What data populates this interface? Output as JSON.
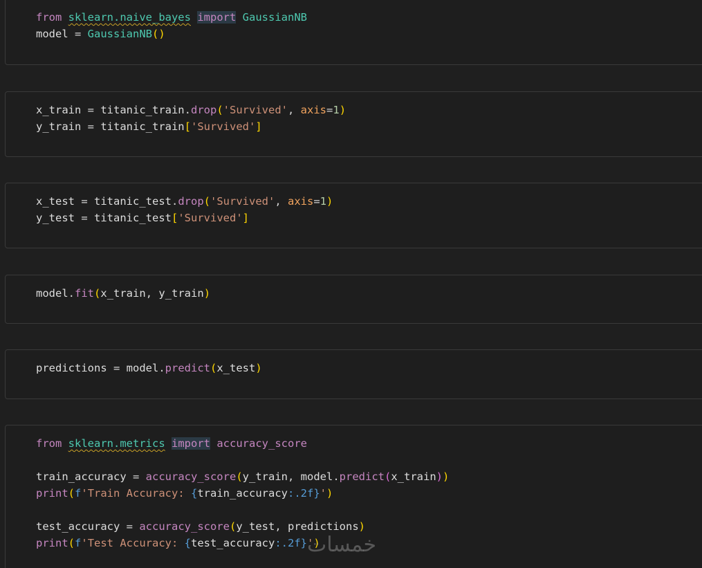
{
  "cells": [
    {
      "name": "cell-import-gaussiannb",
      "lines": [
        [
          [
            "kw",
            "from"
          ],
          [
            "op",
            " "
          ],
          [
            "mod",
            "sklearn.naive_bayes"
          ],
          [
            "op",
            " "
          ],
          [
            "kw-hl",
            "import"
          ],
          [
            "op",
            " "
          ],
          [
            "cls",
            "GaussianNB"
          ]
        ],
        [
          [
            "var",
            "model"
          ],
          [
            "op",
            " = "
          ],
          [
            "cls",
            "GaussianNB"
          ],
          [
            "br1",
            "()"
          ]
        ]
      ]
    },
    {
      "name": "cell-train-split",
      "lines": [
        [
          [
            "var",
            "x_train"
          ],
          [
            "op",
            " = "
          ],
          [
            "var",
            "titanic_train"
          ],
          [
            "op",
            "."
          ],
          [
            "fnp",
            "drop"
          ],
          [
            "br1",
            "("
          ],
          [
            "str",
            "'Survived'"
          ],
          [
            "op",
            ", "
          ],
          [
            "param",
            "axis"
          ],
          [
            "op",
            "="
          ],
          [
            "num",
            "1"
          ],
          [
            "br1",
            ")"
          ]
        ],
        [
          [
            "var",
            "y_train"
          ],
          [
            "op",
            " = "
          ],
          [
            "var",
            "titanic_train"
          ],
          [
            "br1",
            "["
          ],
          [
            "str",
            "'Survived'"
          ],
          [
            "br1",
            "]"
          ]
        ]
      ]
    },
    {
      "name": "cell-test-split",
      "lines": [
        [
          [
            "var",
            "x_test"
          ],
          [
            "op",
            " = "
          ],
          [
            "var",
            "titanic_test"
          ],
          [
            "op",
            "."
          ],
          [
            "fnp",
            "drop"
          ],
          [
            "br1",
            "("
          ],
          [
            "str",
            "'Survived'"
          ],
          [
            "op",
            ", "
          ],
          [
            "param",
            "axis"
          ],
          [
            "op",
            "="
          ],
          [
            "num",
            "1"
          ],
          [
            "br1",
            ")"
          ]
        ],
        [
          [
            "var",
            "y_test"
          ],
          [
            "op",
            " = "
          ],
          [
            "var",
            "titanic_test"
          ],
          [
            "br1",
            "["
          ],
          [
            "str",
            "'Survived'"
          ],
          [
            "br1",
            "]"
          ]
        ]
      ]
    },
    {
      "name": "cell-model-fit",
      "lines": [
        [
          [
            "var",
            "model"
          ],
          [
            "op",
            "."
          ],
          [
            "fnp",
            "fit"
          ],
          [
            "br1",
            "("
          ],
          [
            "var",
            "x_train"
          ],
          [
            "op",
            ", "
          ],
          [
            "var",
            "y_train"
          ],
          [
            "br1",
            ")"
          ]
        ]
      ]
    },
    {
      "name": "cell-predict",
      "lines": [
        [
          [
            "var",
            "predictions"
          ],
          [
            "op",
            " = "
          ],
          [
            "var",
            "model"
          ],
          [
            "op",
            "."
          ],
          [
            "fnp",
            "predict"
          ],
          [
            "br1",
            "("
          ],
          [
            "var",
            "x_test"
          ],
          [
            "br1",
            ")"
          ]
        ]
      ]
    },
    {
      "name": "cell-accuracy",
      "lines": [
        [
          [
            "kw",
            "from"
          ],
          [
            "op",
            " "
          ],
          [
            "mod",
            "sklearn.metrics"
          ],
          [
            "op",
            " "
          ],
          [
            "kw-hl",
            "import"
          ],
          [
            "op",
            " "
          ],
          [
            "fnp",
            "accuracy_score"
          ]
        ],
        [],
        [
          [
            "var",
            "train_accuracy"
          ],
          [
            "op",
            " = "
          ],
          [
            "fnp",
            "accuracy_score"
          ],
          [
            "br1",
            "("
          ],
          [
            "var",
            "y_train"
          ],
          [
            "op",
            ", "
          ],
          [
            "var",
            "model"
          ],
          [
            "op",
            "."
          ],
          [
            "fnp",
            "predict"
          ],
          [
            "br2",
            "("
          ],
          [
            "var",
            "x_train"
          ],
          [
            "br2",
            ")"
          ],
          [
            "br1",
            ")"
          ]
        ],
        [
          [
            "fnp",
            "print"
          ],
          [
            "br1",
            "("
          ],
          [
            "fmt",
            "f"
          ],
          [
            "str",
            "'Train Accuracy: "
          ],
          [
            "fmt",
            "{"
          ],
          [
            "var",
            "train_accuracy"
          ],
          [
            "fmt",
            ":.2f}"
          ],
          [
            "str",
            "'"
          ],
          [
            "br1",
            ")"
          ]
        ],
        [],
        [
          [
            "var",
            "test_accuracy"
          ],
          [
            "op",
            " = "
          ],
          [
            "fnp",
            "accuracy_score"
          ],
          [
            "br1",
            "("
          ],
          [
            "var",
            "y_test"
          ],
          [
            "op",
            ", "
          ],
          [
            "var",
            "predictions"
          ],
          [
            "br1",
            ")"
          ]
        ],
        [
          [
            "fnp",
            "print"
          ],
          [
            "br1",
            "("
          ],
          [
            "fmt",
            "f"
          ],
          [
            "str",
            "'Test Accuracy: "
          ],
          [
            "fmt",
            "{"
          ],
          [
            "var",
            "test_accuracy"
          ],
          [
            "fmt",
            ":.2f}"
          ],
          [
            "str",
            "'"
          ],
          [
            "br1",
            ")"
          ]
        ]
      ]
    }
  ],
  "watermark": "خمسات"
}
